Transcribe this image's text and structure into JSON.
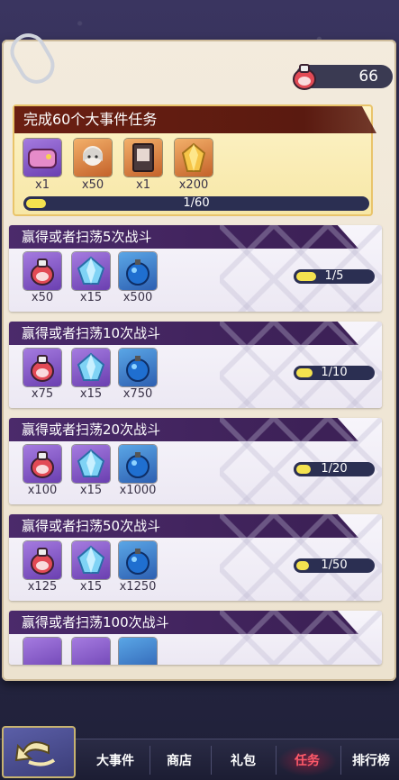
{
  "currency": {
    "value": "66",
    "icon": "potion-currency-icon"
  },
  "main_task": {
    "title": "完成60个大事件任务",
    "rewards": [
      {
        "icon": "purple-bag-icon",
        "qty": "x1",
        "rarity": "purple"
      },
      {
        "icon": "character-portrait-icon",
        "qty": "x50",
        "rarity": "orange"
      },
      {
        "icon": "card-pack-icon",
        "qty": "x1",
        "rarity": "orange"
      },
      {
        "icon": "gold-crystal-icon",
        "qty": "x200",
        "rarity": "orange"
      }
    ],
    "progress_text": "1/60",
    "progress": 0.0167
  },
  "tasks": [
    {
      "title": "赢得或者扫荡5次战斗",
      "rewards": [
        "x50",
        "x15",
        "x500"
      ],
      "progress_text": "1/5",
      "progress": 0.2
    },
    {
      "title": "赢得或者扫荡10次战斗",
      "rewards": [
        "x75",
        "x15",
        "x750"
      ],
      "progress_text": "1/10",
      "progress": 0.1
    },
    {
      "title": "赢得或者扫荡20次战斗",
      "rewards": [
        "x100",
        "x15",
        "x1000"
      ],
      "progress_text": "1/20",
      "progress": 0.05
    },
    {
      "title": "赢得或者扫荡50次战斗",
      "rewards": [
        "x125",
        "x15",
        "x1250"
      ],
      "progress_text": "1/50",
      "progress": 0.02
    },
    {
      "title": "赢得或者扫荡100次战斗",
      "rewards": [],
      "progress_text": "",
      "progress": 0.01
    }
  ],
  "reward_icons": [
    "potion-jar-icon",
    "blue-crystal-icon",
    "blue-bomb-icon"
  ],
  "nav": {
    "back": "back-arrow-icon",
    "items": [
      "大事件",
      "商店",
      "礼包",
      "任务",
      "排行榜"
    ],
    "active": "任务"
  },
  "colors": {
    "progress_fill": "#f4e24f",
    "progress_bg": "#2b2f52",
    "title_purple": "#4b2a6b",
    "title_red": "#6b1f12"
  }
}
